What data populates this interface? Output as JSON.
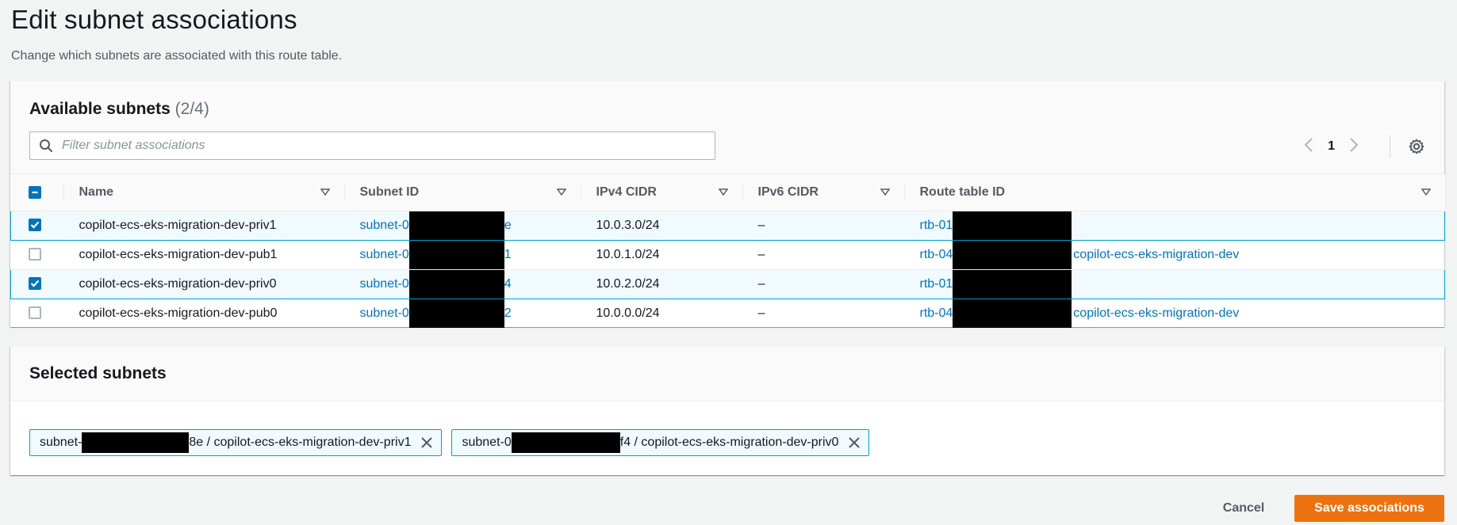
{
  "page": {
    "title": "Edit subnet associations",
    "description": "Change which subnets are associated with this route table."
  },
  "available": {
    "title": "Available subnets",
    "count": "(2/4)",
    "filter_placeholder": "Filter subnet associations",
    "page_number": "1",
    "columns": [
      "Name",
      "Subnet ID",
      "IPv4 CIDR",
      "IPv6 CIDR",
      "Route table ID"
    ],
    "rows": [
      {
        "selected": true,
        "name": "copilot-ecs-eks-migration-dev-priv1",
        "subnet_prefix": "subnet-0",
        "subnet_suffix": "e",
        "ipv4": "10.0.3.0/24",
        "ipv6": "–",
        "rtb_prefix": "rtb-01",
        "rtb_suffix": ""
      },
      {
        "selected": false,
        "name": "copilot-ecs-eks-migration-dev-pub1",
        "subnet_prefix": "subnet-0",
        "subnet_suffix": "1",
        "ipv4": "10.0.1.0/24",
        "ipv6": "–",
        "rtb_prefix": "rtb-04",
        "rtb_suffix": "copilot-ecs-eks-migration-dev"
      },
      {
        "selected": true,
        "name": "copilot-ecs-eks-migration-dev-priv0",
        "subnet_prefix": "subnet-0",
        "subnet_suffix": "4",
        "ipv4": "10.0.2.0/24",
        "ipv6": "–",
        "rtb_prefix": "rtb-01",
        "rtb_suffix": ""
      },
      {
        "selected": false,
        "name": "copilot-ecs-eks-migration-dev-pub0",
        "subnet_prefix": "subnet-0",
        "subnet_suffix": "2",
        "ipv4": "10.0.0.0/24",
        "ipv6": "–",
        "rtb_prefix": "rtb-04",
        "rtb_suffix": "copilot-ecs-eks-migration-dev"
      }
    ]
  },
  "selected": {
    "title": "Selected subnets",
    "tokens": [
      {
        "prefix": "subnet-",
        "suffix": "8e / copilot-ecs-eks-migration-dev-priv1"
      },
      {
        "prefix": "subnet-0",
        "suffix": "f4 / copilot-ecs-eks-migration-dev-priv0"
      }
    ]
  },
  "footer": {
    "cancel_label": "Cancel",
    "save_label": "Save associations"
  },
  "colors": {
    "accent": "#0073bb",
    "primary_button": "#ec7211",
    "selected_row_border": "#00a1c9"
  }
}
